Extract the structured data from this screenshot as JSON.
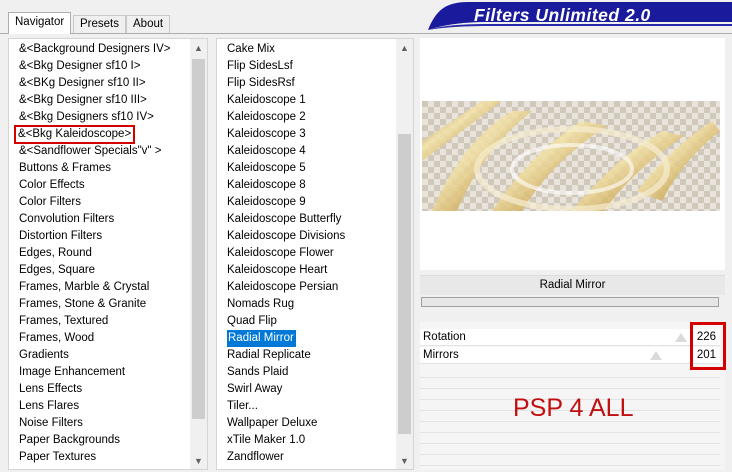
{
  "tabs": [
    {
      "label": "Navigator",
      "active": true
    },
    {
      "label": "Presets",
      "active": false
    },
    {
      "label": "About",
      "active": false
    }
  ],
  "banner": {
    "title": "Filters Unlimited 2.0",
    "color": "#1a1a9c"
  },
  "categories": {
    "items": [
      "&<Background Designers IV>",
      "&<Bkg Designer sf10 I>",
      "&<BKg Designer sf10 II>",
      "&<Bkg Designer sf10 III>",
      "&<Bkg Designers sf10 IV>",
      "&<Bkg Kaleidoscope>",
      "&<Sandflower Specials\"v\" >",
      "Buttons & Frames",
      "Color Effects",
      "Color Filters",
      "Convolution Filters",
      "Distortion Filters",
      "Edges, Round",
      "Edges, Square",
      "Frames, Marble & Crystal",
      "Frames, Stone & Granite",
      "Frames, Textured",
      "Frames, Wood",
      "Gradients",
      "Image Enhancement",
      "Lens Effects",
      "Lens Flares",
      "Noise Filters",
      "Paper Backgrounds",
      "Paper Textures"
    ],
    "highlighted": "&<Bkg Kaleidoscope>"
  },
  "filters": {
    "items": [
      "Cake Mix",
      "Flip SidesLsf",
      "Flip SidesRsf",
      "Kaleidoscope 1",
      "Kaleidoscope 2",
      "Kaleidoscope 3",
      "Kaleidoscope 4",
      "Kaleidoscope 5",
      "Kaleidoscope 8",
      "Kaleidoscope 9",
      "Kaleidoscope Butterfly",
      "Kaleidoscope Divisions",
      "Kaleidoscope Flower",
      "Kaleidoscope Heart",
      "Kaleidoscope Persian",
      "Nomads Rug",
      "Quad Flip",
      "Radial Mirror",
      "Radial Replicate",
      "Sands Plaid",
      "Swirl Away",
      "Tiler...",
      "Wallpaper Deluxe",
      "xTile Maker 1.0",
      "Zandflower"
    ],
    "selected": "Radial Mirror"
  },
  "preview": {
    "filter_name": "Radial Mirror"
  },
  "params": [
    {
      "label": "Rotation",
      "value": "226"
    },
    {
      "label": "Mirrors",
      "value": "201"
    }
  ],
  "watermark": "PSP 4 ALL",
  "colors": {
    "highlight": "#0078d7",
    "annotation_red": "#d40000",
    "watermark_red": "#c01010"
  }
}
